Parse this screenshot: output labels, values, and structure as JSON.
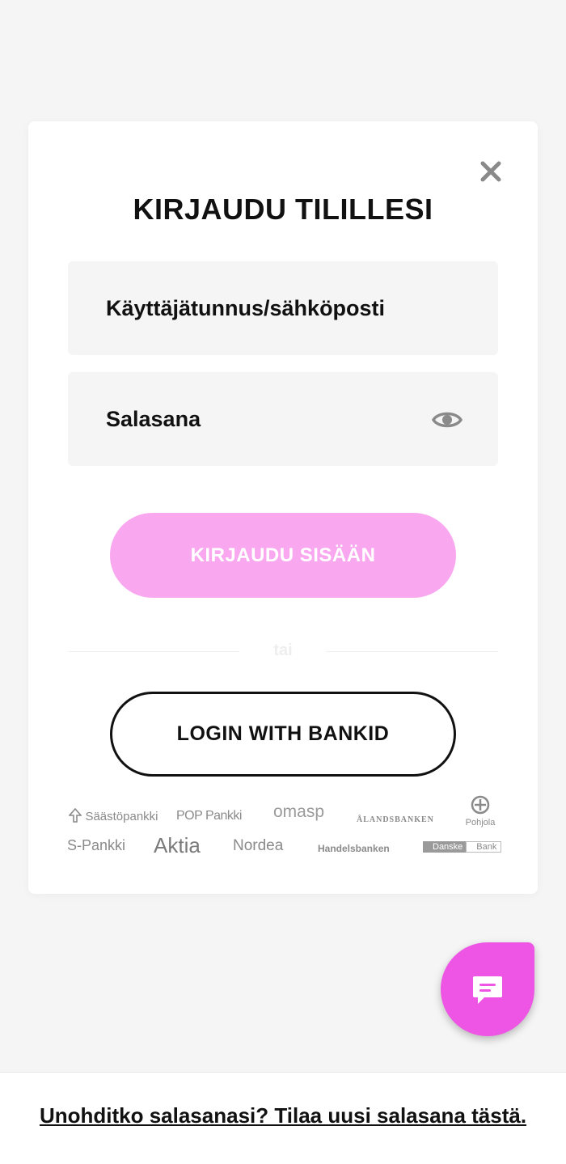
{
  "modal": {
    "title": "KIRJAUDU TILILLESI",
    "username_placeholder": "Käyttäjätunnus/sähköposti",
    "password_placeholder": "Salasana",
    "login_button": "KIRJAUDU SISÄÄN",
    "divider_text": "tai",
    "bankid_button": "LOGIN WITH BANKID"
  },
  "banks": {
    "saastopankki": "Säästöpankki",
    "pop_pankki": "POP Pankki",
    "omasp": "omasp",
    "alandsbanken": "ÅLANDSBANKEN",
    "pohjola": "Pohjola",
    "s_pankki": "S-Pankki",
    "aktia": "Aktia",
    "nordea": "Nordea",
    "handelsbanken": "Handelsbanken",
    "danske_bank_box": "Danske",
    "danske_bank_text": "Bank"
  },
  "footer": {
    "forgot_link": "Unohditko salasanasi? Tilaa uusi salasana tästä."
  },
  "icons": {
    "close": "close-icon",
    "eye": "eye-icon",
    "chat": "chat-icon"
  },
  "colors": {
    "background": "#f5f5f5",
    "login_button": "#f9a8f0",
    "chat_button": "#ee55e5",
    "text": "#111111"
  }
}
